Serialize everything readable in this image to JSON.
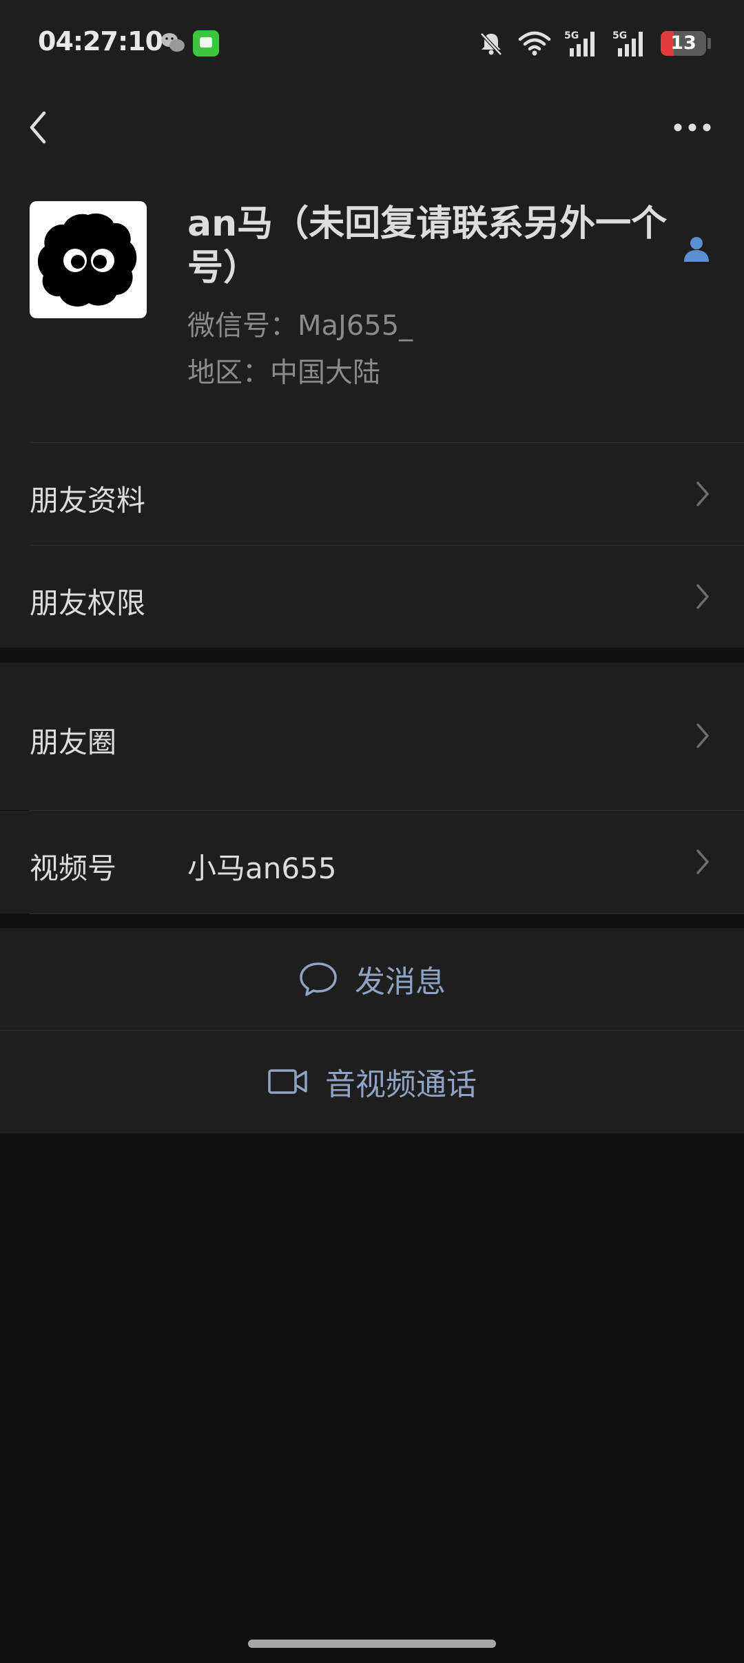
{
  "status_bar": {
    "time": "04:27:10",
    "battery_level": "13",
    "battery_fraction": 0.13,
    "icons": [
      "wechat-icon",
      "message-app-icon",
      "mute-icon",
      "wifi-icon",
      "5g-signal-icon",
      "5g-signal-icon",
      "battery-icon"
    ],
    "signal_labels": [
      "5G",
      "5G"
    ]
  },
  "nav": {
    "back_icon": "chevron-left-icon",
    "more_icon": "more-dots-icon"
  },
  "profile": {
    "name": "an马（未回复请联系另外一个号）",
    "wechat_id": "微信号：MaJ655_",
    "region": "地区：中国大陆",
    "contact_icon": "contact-person-icon",
    "accent_color": "#5b8fd6"
  },
  "menu": {
    "friend_info": "朋友资料",
    "friend_permissions": "朋友权限",
    "moments": "朋友圈",
    "channels_label": "视频号",
    "channels_value": "小马an655"
  },
  "actions": {
    "send_message": "发消息",
    "voice_video_call": "音视频通话",
    "color": "#8fa3c4"
  }
}
